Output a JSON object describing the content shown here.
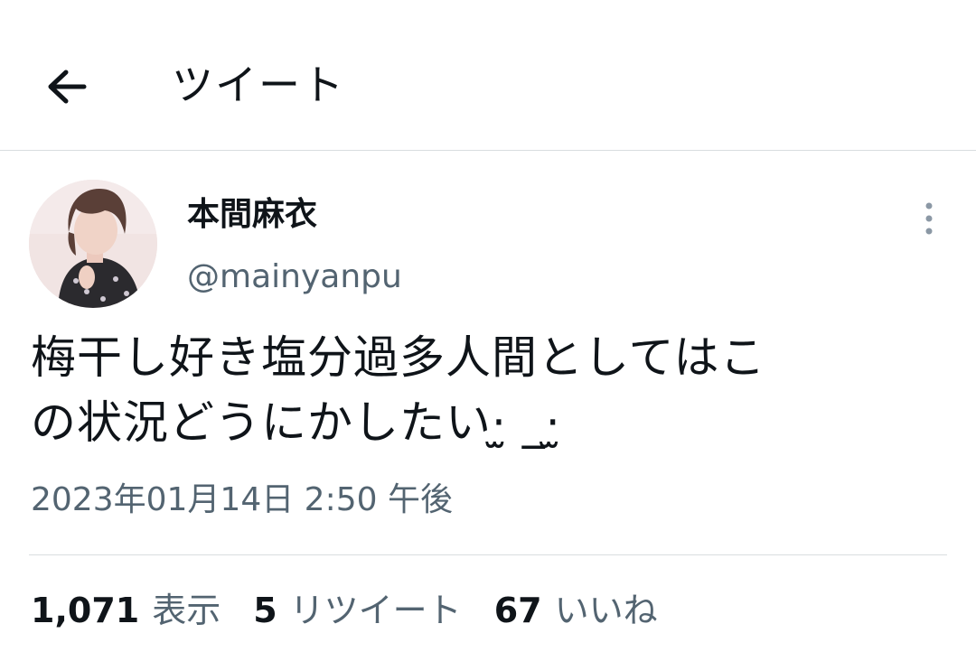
{
  "header": {
    "back_icon": "arrow-left-icon",
    "title": "ツイート"
  },
  "tweet": {
    "author": {
      "name": "本間麻衣",
      "handle": "@mainyanpu"
    },
    "more_icon": "more-vertical-icon",
    "text": "梅干し好き塩分過多人間としてはこ\nの状況どうにかしたい·̫ _·̫",
    "timestamp": "2023年01月14日 2:50 午後"
  },
  "stats": {
    "views": {
      "count": "1,071",
      "label": "表示"
    },
    "retweets": {
      "count": "5",
      "label": "リツイート"
    },
    "likes": {
      "count": "67",
      "label": "いいね"
    }
  }
}
